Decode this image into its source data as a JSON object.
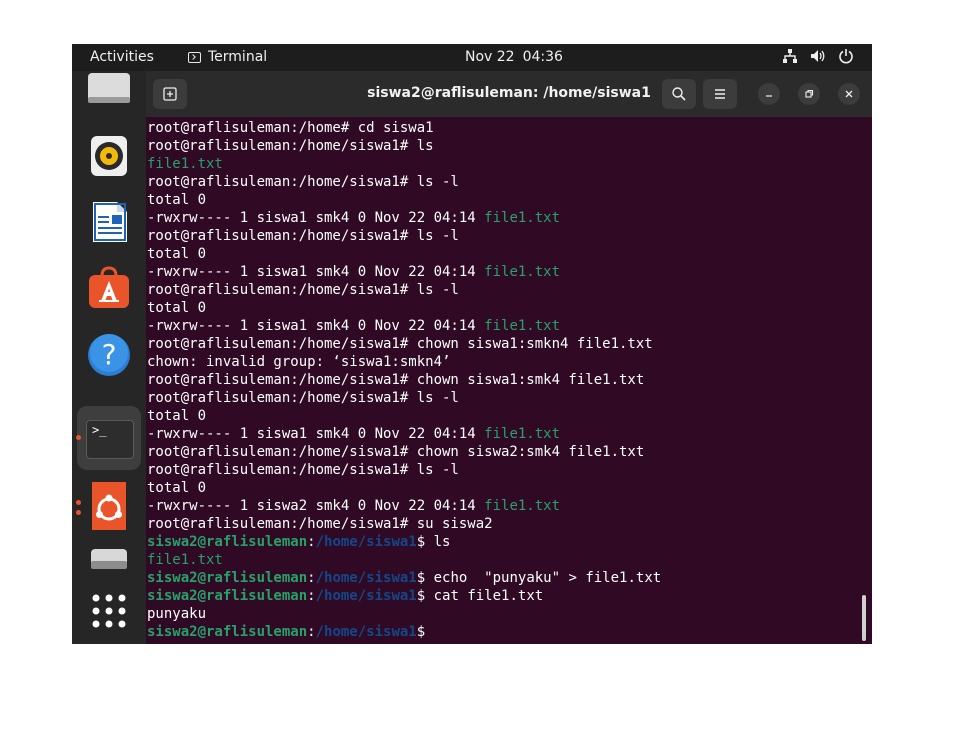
{
  "topbar": {
    "activities": "Activities",
    "app_name": "Terminal",
    "date": "Nov 22",
    "time": "04:36",
    "icons": [
      "network-icon",
      "volume-icon",
      "power-icon"
    ]
  },
  "dock": {
    "items": [
      "files-icon",
      "rhythmbox-icon",
      "writer-icon",
      "app-center-icon",
      "help-icon",
      "terminal-icon",
      "ubuntu-icon",
      "drive-icon",
      "app-grid-icon"
    ],
    "terminal_glyph": ">_"
  },
  "window": {
    "title": "siswa2@raflisuleman: /home/siswa1"
  },
  "terminal": {
    "lines": [
      [
        {
          "t": "plain",
          "v": "root@raflisuleman:/home# cd siswa1"
        }
      ],
      [
        {
          "t": "plain",
          "v": "root@raflisuleman:/home/siswa1# ls"
        }
      ],
      [
        {
          "t": "file",
          "v": "file1.txt"
        }
      ],
      [
        {
          "t": "plain",
          "v": "root@raflisuleman:/home/siswa1# ls -l"
        }
      ],
      [
        {
          "t": "plain",
          "v": "total 0"
        }
      ],
      [
        {
          "t": "plain",
          "v": "-rwxrw---- 1 siswa1 smk4 0 Nov 22 04:14 "
        },
        {
          "t": "file",
          "v": "file1.txt"
        }
      ],
      [
        {
          "t": "plain",
          "v": "root@raflisuleman:/home/siswa1# ls -l"
        }
      ],
      [
        {
          "t": "plain",
          "v": "total 0"
        }
      ],
      [
        {
          "t": "plain",
          "v": "-rwxrw---- 1 siswa1 smk4 0 Nov 22 04:14 "
        },
        {
          "t": "file",
          "v": "file1.txt"
        }
      ],
      [
        {
          "t": "plain",
          "v": "root@raflisuleman:/home/siswa1# ls -l"
        }
      ],
      [
        {
          "t": "plain",
          "v": "total 0"
        }
      ],
      [
        {
          "t": "plain",
          "v": "-rwxrw---- 1 siswa1 smk4 0 Nov 22 04:14 "
        },
        {
          "t": "file",
          "v": "file1.txt"
        }
      ],
      [
        {
          "t": "plain",
          "v": "root@raflisuleman:/home/siswa1# chown siswa1:smkn4 file1.txt"
        }
      ],
      [
        {
          "t": "plain",
          "v": "chown: invalid group: ‘siswa1:smkn4’"
        }
      ],
      [
        {
          "t": "plain",
          "v": "root@raflisuleman:/home/siswa1# chown siswa1:smk4 file1.txt"
        }
      ],
      [
        {
          "t": "plain",
          "v": "root@raflisuleman:/home/siswa1# ls -l"
        }
      ],
      [
        {
          "t": "plain",
          "v": "total 0"
        }
      ],
      [
        {
          "t": "plain",
          "v": "-rwxrw---- 1 siswa1 smk4 0 Nov 22 04:14 "
        },
        {
          "t": "file",
          "v": "file1.txt"
        }
      ],
      [
        {
          "t": "plain",
          "v": "root@raflisuleman:/home/siswa1# chown siswa2:smk4 file1.txt"
        }
      ],
      [
        {
          "t": "plain",
          "v": "root@raflisuleman:/home/siswa1# ls -l"
        }
      ],
      [
        {
          "t": "plain",
          "v": "total 0"
        }
      ],
      [
        {
          "t": "plain",
          "v": "-rwxrw---- 1 siswa2 smk4 0 Nov 22 04:14 "
        },
        {
          "t": "file",
          "v": "file1.txt"
        }
      ],
      [
        {
          "t": "plain",
          "v": "root@raflisuleman:/home/siswa1# su siswa2"
        }
      ],
      [
        {
          "t": "user",
          "v": "siswa2@raflisuleman"
        },
        {
          "t": "plain",
          "v": ":"
        },
        {
          "t": "path",
          "v": "/home/siswa1"
        },
        {
          "t": "plain",
          "v": "$ ls"
        }
      ],
      [
        {
          "t": "file",
          "v": "file1.txt"
        }
      ],
      [
        {
          "t": "user",
          "v": "siswa2@raflisuleman"
        },
        {
          "t": "plain",
          "v": ":"
        },
        {
          "t": "path",
          "v": "/home/siswa1"
        },
        {
          "t": "plain",
          "v": "$ echo  \"punyaku\" > file1.txt"
        }
      ],
      [
        {
          "t": "user",
          "v": "siswa2@raflisuleman"
        },
        {
          "t": "plain",
          "v": ":"
        },
        {
          "t": "path",
          "v": "/home/siswa1"
        },
        {
          "t": "plain",
          "v": "$ cat file1.txt"
        }
      ],
      [
        {
          "t": "plain",
          "v": "punyaku"
        }
      ],
      [
        {
          "t": "user",
          "v": "siswa2@raflisuleman"
        },
        {
          "t": "plain",
          "v": ":"
        },
        {
          "t": "path",
          "v": "/home/siswa1"
        },
        {
          "t": "plain",
          "v": "$ "
        }
      ]
    ]
  },
  "colors": {
    "terminal_bg": "#300a24",
    "file_green": "#26a269",
    "path_blue": "#12488b",
    "accent_orange": "#e9542b"
  }
}
